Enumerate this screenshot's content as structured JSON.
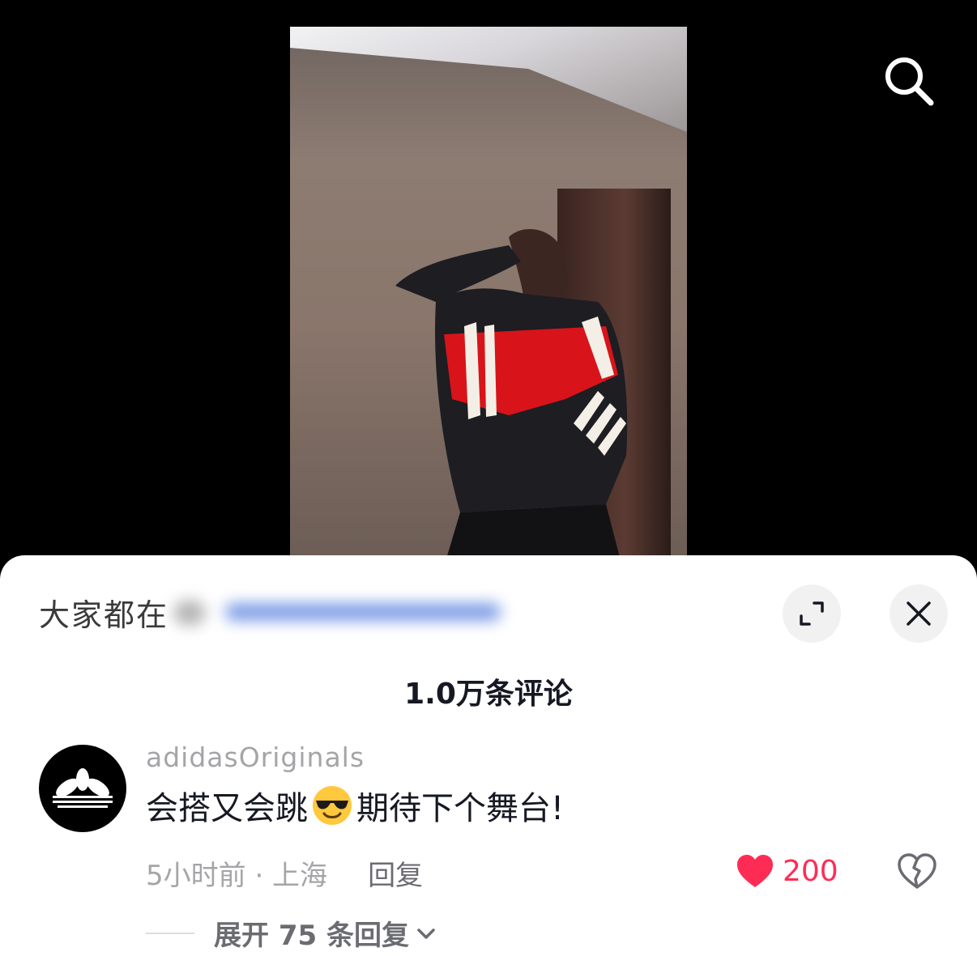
{
  "video": {
    "search_icon": "search-icon"
  },
  "sheet": {
    "trending_prefix": "大家都在",
    "expand_icon": "expand-icon",
    "close_icon": "close-icon",
    "comment_count": "1.0万条评论"
  },
  "comments": [
    {
      "username": "adidasOriginals",
      "text_before": "会搭又会跳",
      "emoji": "sunglasses-emoji",
      "text_after": "期待下个舞台!",
      "time_location": "5小时前 · 上海",
      "reply_label": "回复",
      "likes": "200",
      "expand_replies": "展开 75 条回复"
    }
  ],
  "colors": {
    "accent": "#fe2c55",
    "muted": "#a5a5a8",
    "text": "#161823"
  }
}
